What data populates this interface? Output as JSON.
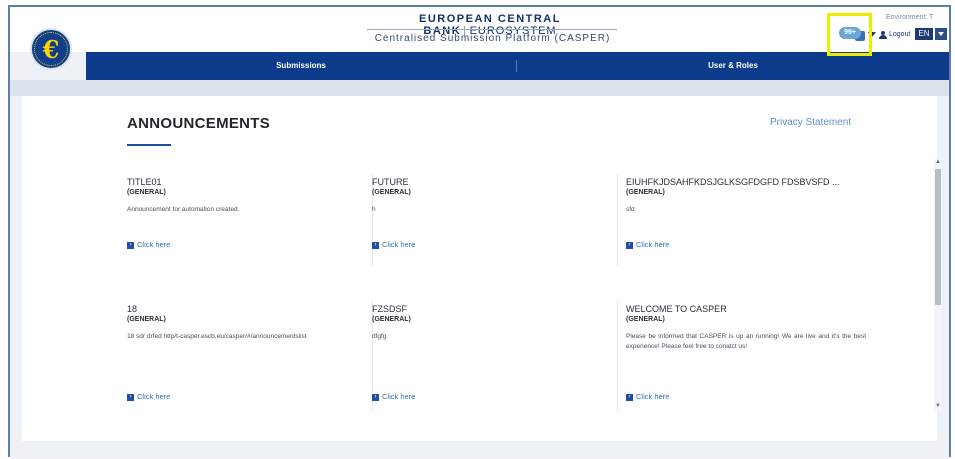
{
  "header": {
    "bank_name": "EUROPEAN CENTRAL BANK",
    "bank_sub": "EUROSYSTEM",
    "platform": "Centralised Submission Platform (CASPER)",
    "notification_badge": "99+",
    "environment": "Environment: T",
    "logout": "Logout",
    "language": "EN"
  },
  "nav": {
    "items": [
      {
        "label": "Submissions"
      },
      {
        "label": "User & Roles"
      }
    ]
  },
  "page": {
    "title": "ANNOUNCEMENTS",
    "privacy": "Privacy Statement"
  },
  "announcements": [
    {
      "title": "TITLE01",
      "type": "(GENERAL)",
      "desc": "Announcement for automation created.",
      "link": "Click here"
    },
    {
      "title": "FUTURE",
      "type": "(GENERAL)",
      "desc": "h",
      "link": "Click here"
    },
    {
      "title": "EIUHFKJDSAHFKDSJGLKSGFDGFD FDSBVSFD ...",
      "type": "(GENERAL)",
      "desc": "sfd",
      "link": "Click here"
    },
    {
      "title": "18",
      "type": "(GENERAL)",
      "desc": "18 sdr drfed http/t-casper.escb.eu/casper/#/announcementslist",
      "link": "Click here"
    },
    {
      "title": "FZSDSF",
      "type": "(GENERAL)",
      "desc": "dfgfg",
      "link": "Click here"
    },
    {
      "title": "WELCOME TO CASPER",
      "type": "(GENERAL)",
      "desc": "Please be informed that CASPER is up an running! We are live and it's the best experience! Please feel free to conatct us!",
      "link": "Click here"
    }
  ],
  "colors": {
    "navbar": "#0d3b8c",
    "link": "#2f6fc0",
    "highlight": "#f0ec00"
  },
  "icons": [
    "ecb-logo-icon",
    "notification-icon",
    "chevron-down-icon",
    "user-icon",
    "arrow-right-icon",
    "scroll-up-icon",
    "scroll-down-icon"
  ]
}
